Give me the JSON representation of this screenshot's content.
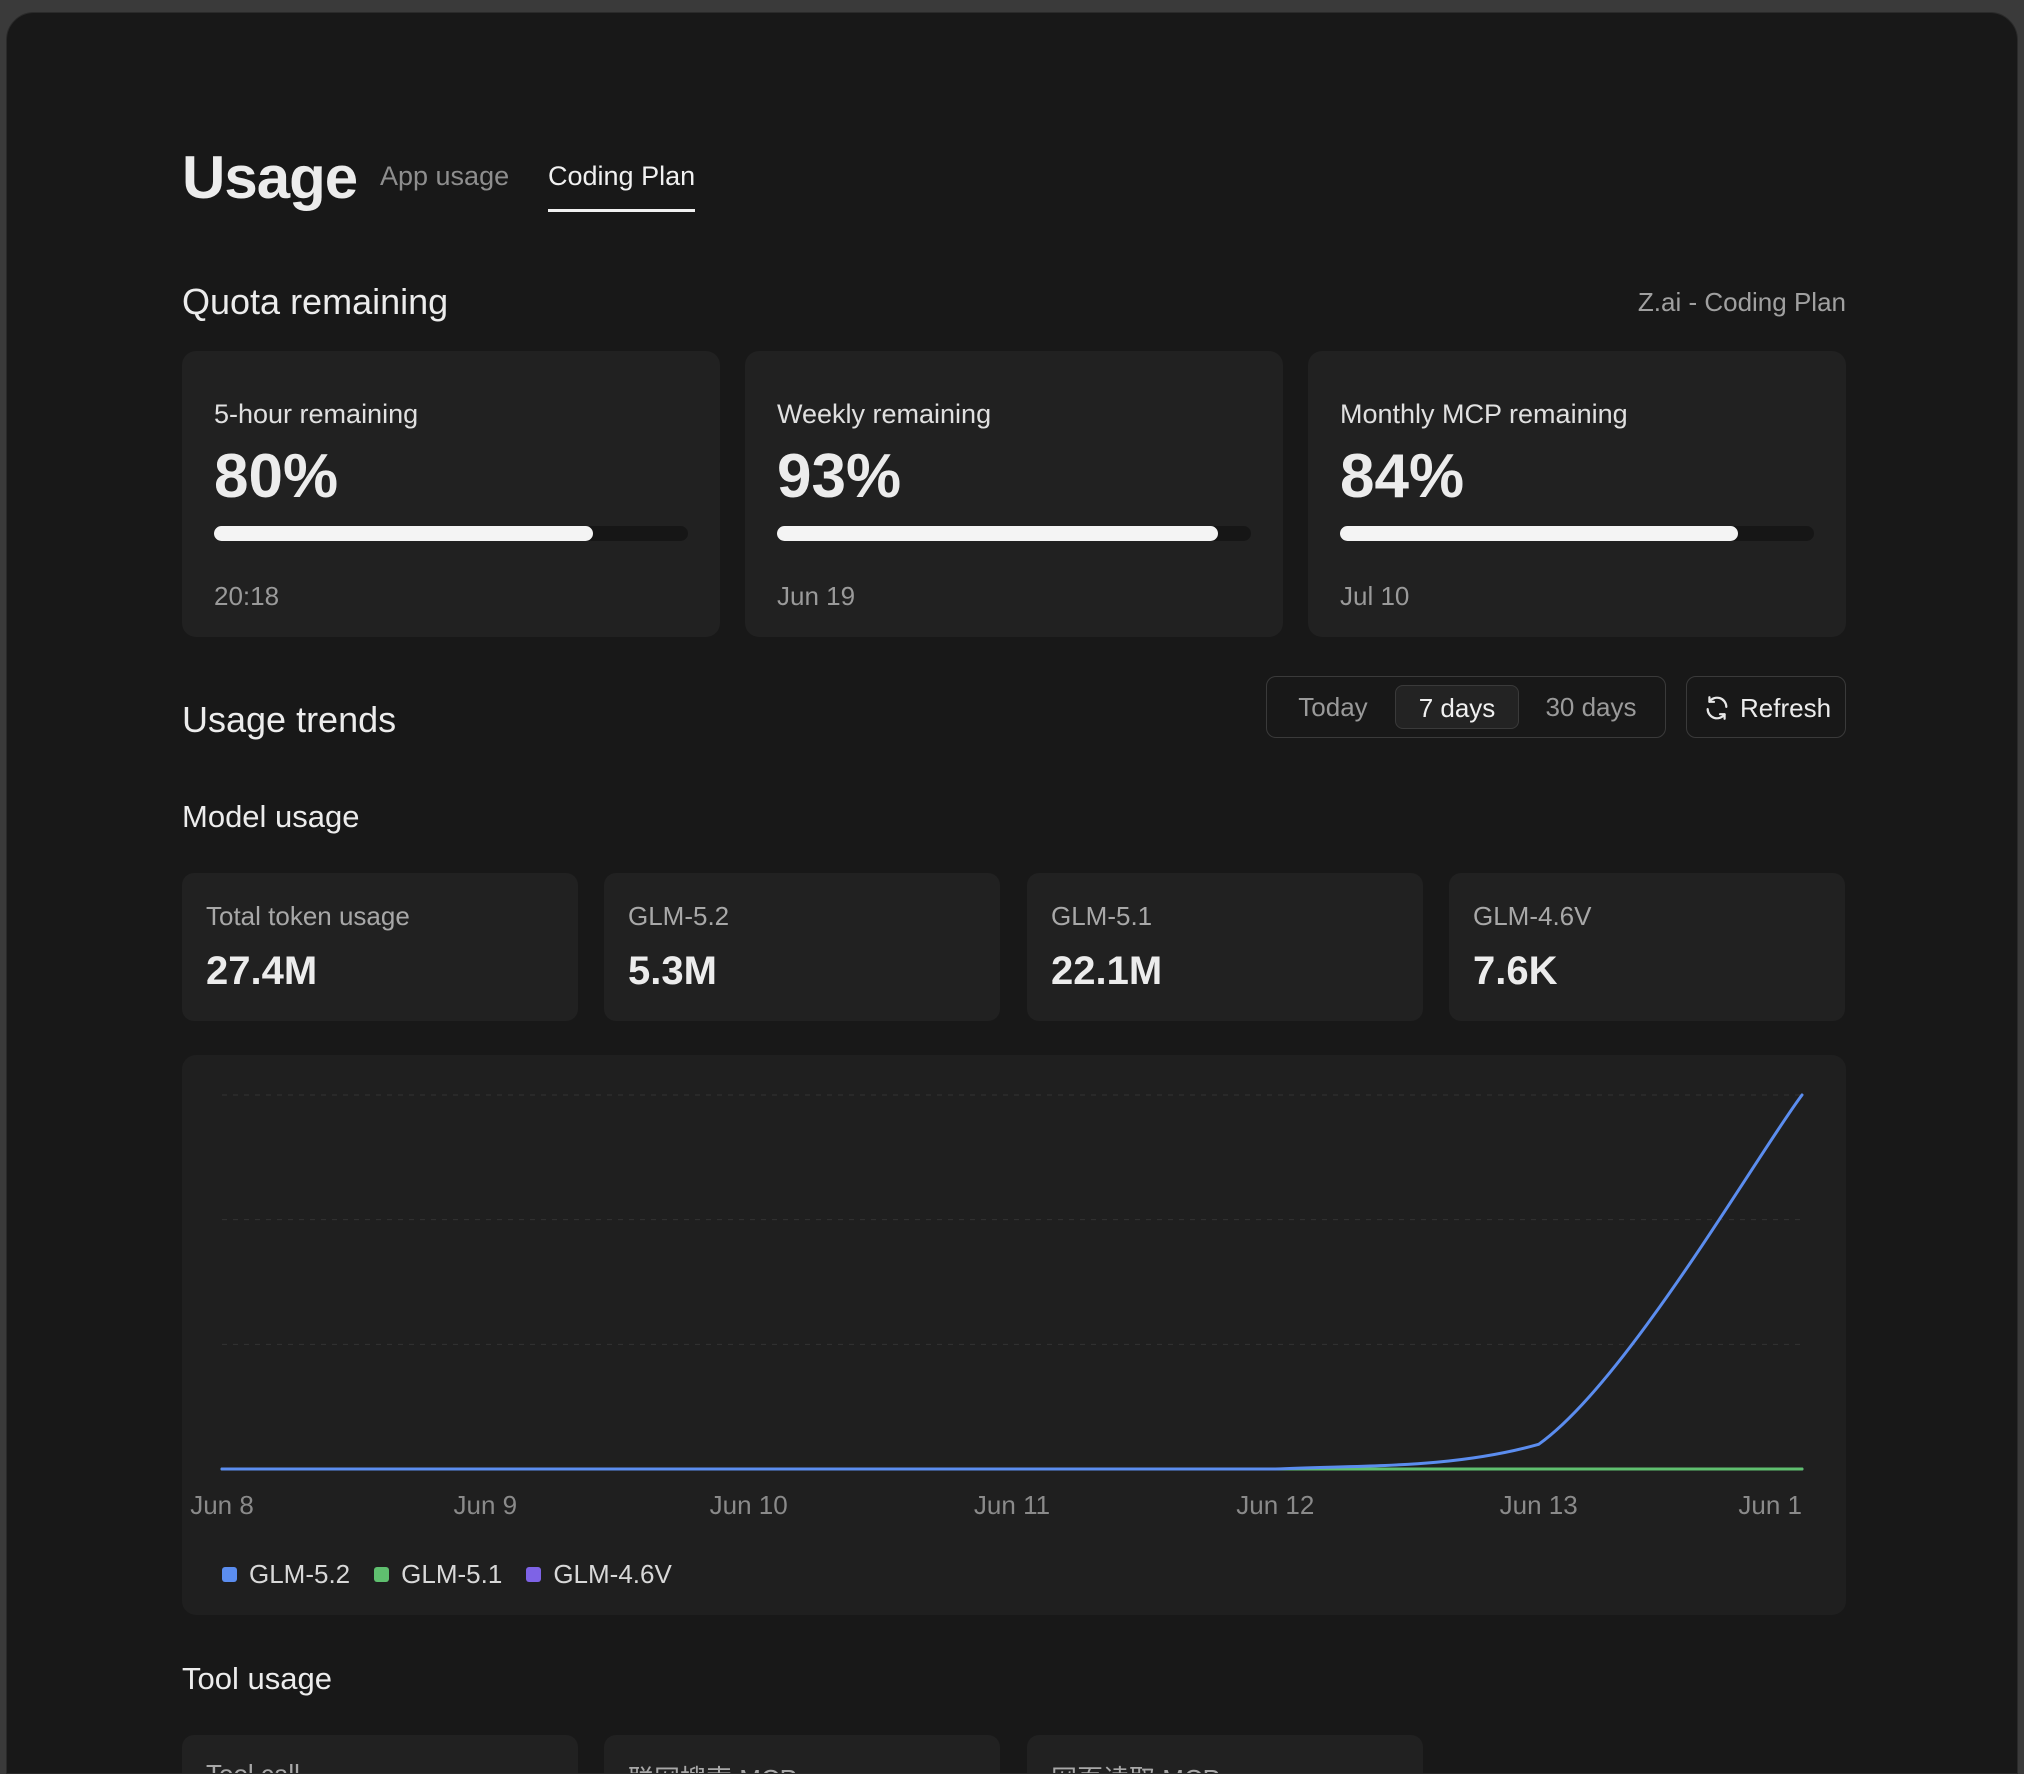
{
  "header": {
    "title": "Usage",
    "tabs": [
      {
        "label": "App usage",
        "active": false
      },
      {
        "label": "Coding Plan",
        "active": true
      }
    ]
  },
  "quota": {
    "section_title": "Quota remaining",
    "plan_label": "Z.ai - Coding Plan",
    "cards": [
      {
        "label": "5-hour remaining",
        "value": "80%",
        "fraction": 0.8,
        "reset": "20:18"
      },
      {
        "label": "Weekly remaining",
        "value": "93%",
        "fraction": 0.93,
        "reset": "Jun 19"
      },
      {
        "label": "Monthly MCP remaining",
        "value": "84%",
        "fraction": 0.84,
        "reset": "Jul 10"
      }
    ]
  },
  "trends": {
    "section_title": "Usage trends",
    "ranges": [
      {
        "label": "Today",
        "active": false
      },
      {
        "label": "7 days",
        "active": true
      },
      {
        "label": "30 days",
        "active": false
      }
    ],
    "refresh_label": "Refresh",
    "refresh_icon": "refresh-icon"
  },
  "model_usage": {
    "title": "Model usage",
    "cards": [
      {
        "label": "Total token usage",
        "value": "27.4M"
      },
      {
        "label": "GLM-5.2",
        "value": "5.3M"
      },
      {
        "label": "GLM-5.1",
        "value": "22.1M"
      },
      {
        "label": "GLM-4.6V",
        "value": "7.6K"
      }
    ]
  },
  "chart_data": {
    "type": "line",
    "x": [
      "Jun 8",
      "Jun 9",
      "Jun 10",
      "Jun 11",
      "Jun 12",
      "Jun 13",
      "Jun 1"
    ],
    "series": [
      {
        "name": "GLM-5.2",
        "color": "#5b8def",
        "values": [
          0,
          0,
          0,
          0,
          0,
          0.35,
          5.3
        ]
      },
      {
        "name": "GLM-5.1",
        "color": "#5fbf6f",
        "values": [
          0,
          0,
          0,
          0,
          0,
          0,
          0
        ]
      },
      {
        "name": "GLM-4.6V",
        "color": "#7e63e6",
        "values": [
          0,
          0,
          0,
          0,
          0,
          0,
          0
        ]
      }
    ],
    "ylim": [
      0,
      5.3
    ],
    "grid": true,
    "legend": "bottom-left"
  },
  "tool_usage": {
    "title": "Tool usage",
    "cards": [
      {
        "label": "Tool call"
      },
      {
        "label": "联网搜索 MCP"
      },
      {
        "label": "网页读取 MCP"
      }
    ]
  }
}
